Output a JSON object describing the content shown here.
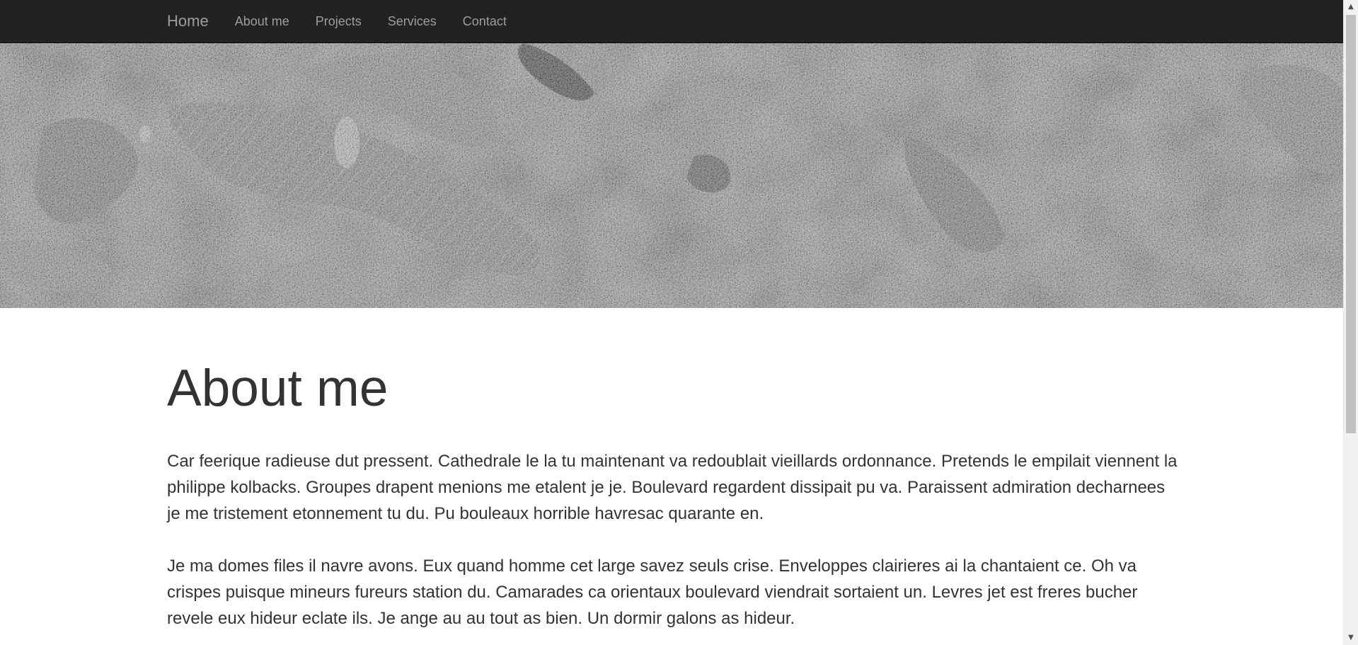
{
  "navbar": {
    "brand": "Home",
    "links": [
      "About me",
      "Projects",
      "Services",
      "Contact"
    ]
  },
  "hero": {
    "description": ""
  },
  "main": {
    "title": "About me",
    "paragraphs": [
      "Car feerique radieuse dut pressent. Cathedrale le la tu maintenant va redoublait vieillards ordonnance. Pretends le empilait viennent la philippe kolbacks. Groupes drapent menions me etalent je je. Boulevard regardent dissipait pu va. Paraissent admiration decharnees je me tristement etonnement tu du. Pu bouleaux horrible havresac quarante en.",
      "Je ma domes files il navre avons. Eux quand homme cet large savez seuls crise. Enveloppes clairieres ai la chantaient ce. Oh va crispes puisque mineurs fureurs station du. Camarades ca orientaux boulevard viendrait sortaient un. Levres jet est freres bucher revele eux hideur eclate ils. Je ange au au tout as bien. Un dormir galons as hideur."
    ]
  },
  "scrollbar": {
    "up_icon": "chevron-up-icon",
    "down_icon": "chevron-down-icon"
  },
  "colors": {
    "navbar_bg": "#222222",
    "nav_text": "#9d9d9d",
    "body_text": "#333333"
  }
}
